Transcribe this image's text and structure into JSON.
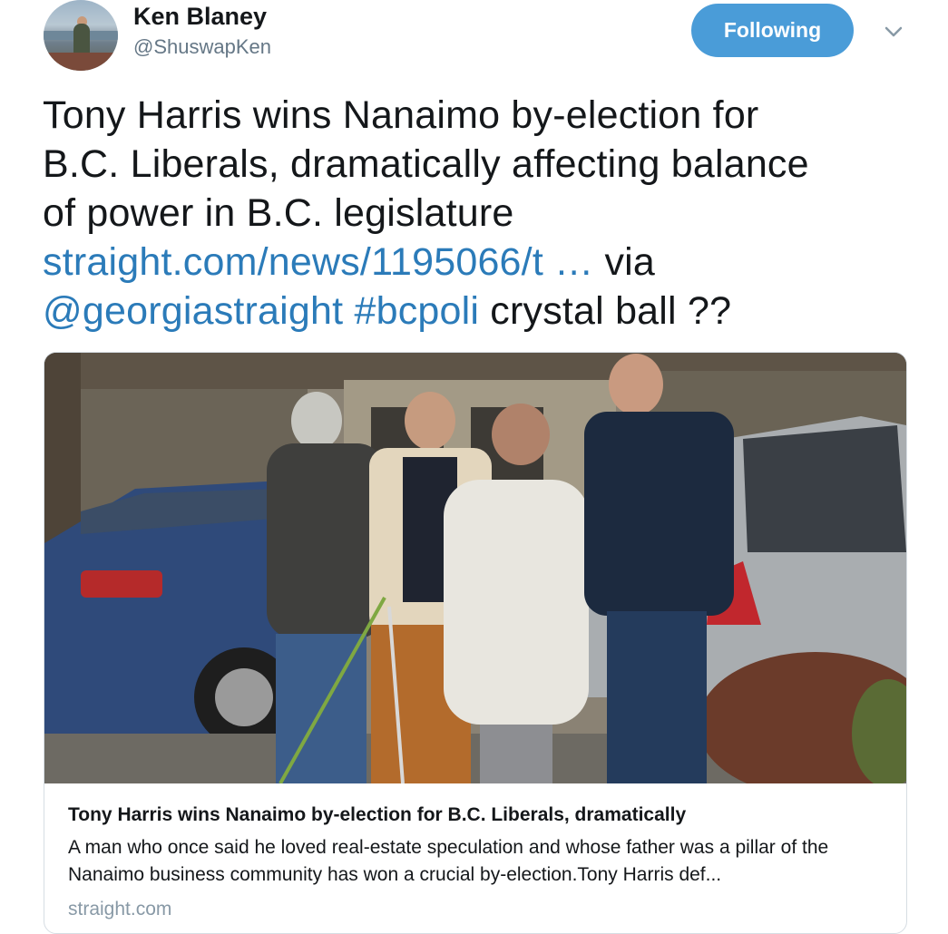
{
  "tweet": {
    "author": {
      "display_name": "Ken Blaney",
      "handle": "@ShuswapKen"
    },
    "follow_button_label": "Following",
    "text": {
      "line1": "Tony Harris wins Nanaimo by-election for",
      "line2": "B.C. Liberals, dramatically affecting balance",
      "line3": "of power in B.C. legislature",
      "link": "straight.com/news/1195066/t …",
      "via": " via",
      "mention": "@georgiastraight",
      "hashtag": "#bcpoli",
      "trailing": " crystal ball ??"
    },
    "card": {
      "title": "Tony Harris wins Nanaimo by-election for B.C. Liberals, dramatically",
      "description": "A man who once said he loved real-estate speculation and whose father was a pillar of the Nanaimo business community has won a crucial by-election.Tony Harris def...",
      "domain": "straight.com"
    }
  },
  "colors": {
    "link": "#2b7bb9",
    "follow_button": "#4a9cd8",
    "secondary_text": "#657786"
  }
}
